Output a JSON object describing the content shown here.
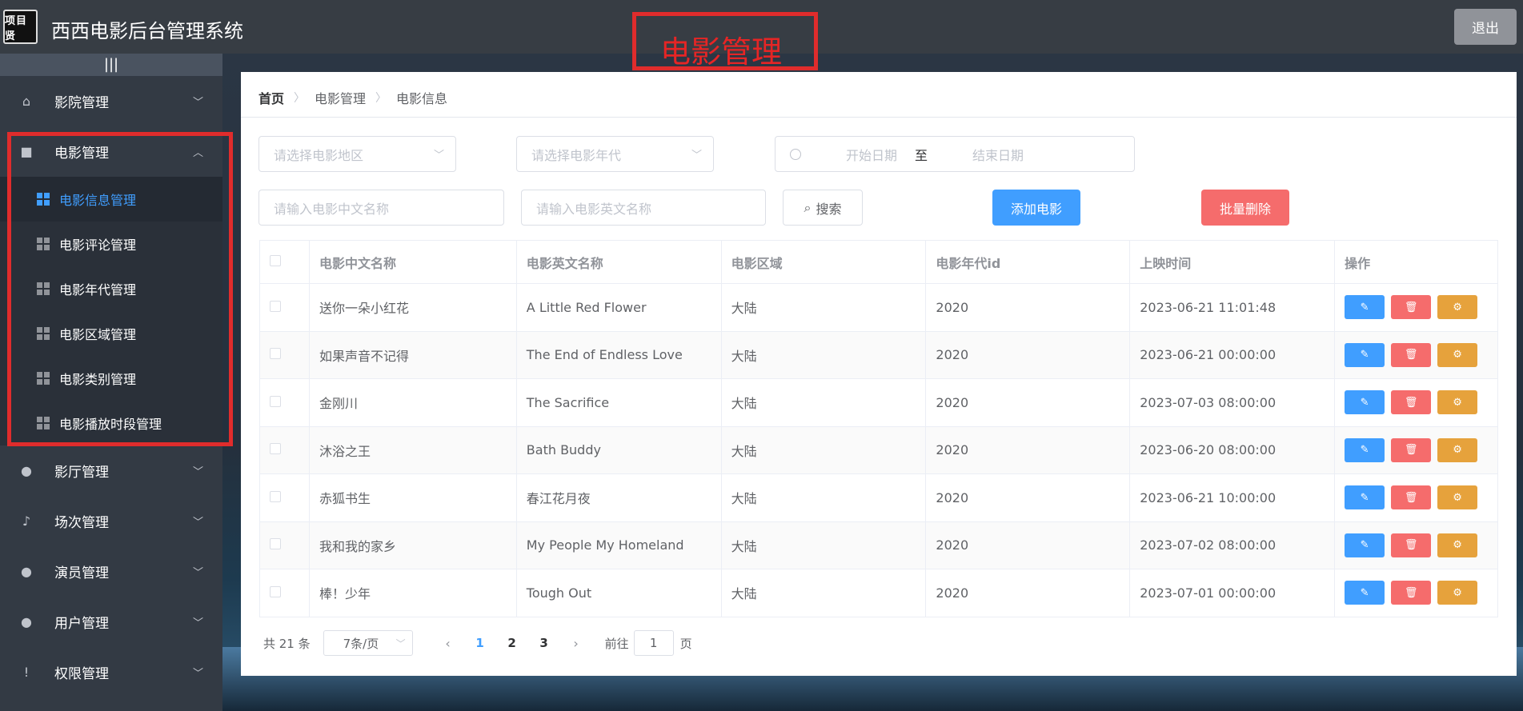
{
  "header": {
    "logo_text": "项目贤",
    "title": "西西电影后台管理系统",
    "banner": "电影管理",
    "logout": "退出"
  },
  "sidebar": {
    "collapse_icon": "|||",
    "menus": [
      {
        "label": "影院管理",
        "icon": "home-icon"
      },
      {
        "label": "电影管理",
        "icon": "camera-icon",
        "expanded": true
      },
      {
        "label": "影厅管理",
        "icon": "cinema-icon"
      },
      {
        "label": "场次管理",
        "icon": "bell-icon"
      },
      {
        "label": "演员管理",
        "icon": "user-icon"
      },
      {
        "label": "用户管理",
        "icon": "user-icon"
      },
      {
        "label": "权限管理",
        "icon": "warning-icon"
      }
    ],
    "submenu": [
      {
        "label": "电影信息管理",
        "active": true
      },
      {
        "label": "电影评论管理"
      },
      {
        "label": "电影年代管理"
      },
      {
        "label": "电影区域管理"
      },
      {
        "label": "电影类别管理"
      },
      {
        "label": "电影播放时段管理"
      }
    ]
  },
  "breadcrumb": [
    "首页",
    "电影管理",
    "电影信息"
  ],
  "filters": {
    "region_placeholder": "请选择电影地区",
    "year_placeholder": "请选择电影年代",
    "start_date_placeholder": "开始日期",
    "date_separator": "至",
    "end_date_placeholder": "结束日期",
    "cn_name_placeholder": "请输入电影中文名称",
    "en_name_placeholder": "请输入电影英文名称",
    "search_label": "搜索",
    "add_label": "添加电影",
    "batch_delete_label": "批量删除"
  },
  "table": {
    "columns": [
      "电影中文名称",
      "电影英文名称",
      "电影区域",
      "电影年代id",
      "上映时间",
      "操作"
    ],
    "rows": [
      {
        "cn": "送你一朵小红花",
        "en": "A Little Red Flower",
        "region": "大陆",
        "year": "2020",
        "date": "2023-06-21 11:01:48"
      },
      {
        "cn": "如果声音不记得",
        "en": "The End of Endless Love",
        "region": "大陆",
        "year": "2020",
        "date": "2023-06-21 00:00:00"
      },
      {
        "cn": "金刚川",
        "en": "The Sacrifice",
        "region": "大陆",
        "year": "2020",
        "date": "2023-07-03 08:00:00"
      },
      {
        "cn": "沐浴之王",
        "en": "Bath Buddy",
        "region": "大陆",
        "year": "2020",
        "date": "2023-06-20 08:00:00"
      },
      {
        "cn": "赤狐书生",
        "en": "春江花月夜",
        "region": "大陆",
        "year": "2020",
        "date": "2023-06-21 10:00:00"
      },
      {
        "cn": "我和我的家乡",
        "en": "My People My Homeland",
        "region": "大陆",
        "year": "2020",
        "date": "2023-07-02 08:00:00"
      },
      {
        "cn": "棒！少年",
        "en": "Tough Out",
        "region": "大陆",
        "year": "2020",
        "date": "2023-07-01 00:00:00"
      }
    ]
  },
  "pagination": {
    "total": "共 21 条",
    "page_size": "7条/页",
    "pages": [
      "1",
      "2",
      "3"
    ],
    "current": "1",
    "goto_prefix": "前往",
    "goto_value": "1",
    "goto_suffix": "页"
  },
  "colors": {
    "primary": "#409eff",
    "danger": "#f56c6c",
    "warning": "#e6a23c",
    "highlight": "#e02c2c"
  }
}
